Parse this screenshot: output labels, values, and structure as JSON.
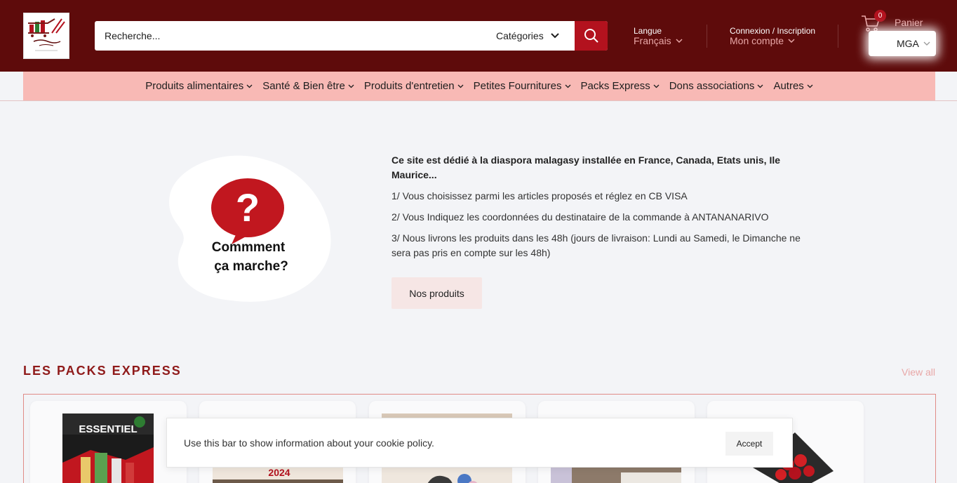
{
  "header": {
    "search_placeholder": "Recherche...",
    "categories_label": "Catégories",
    "language_label": "Langue",
    "language_value": "Français",
    "account_label": "Connexion / Inscription",
    "account_value": "Mon compte",
    "cart_count": "0",
    "cart_label": "Panier",
    "currency": "MGA"
  },
  "nav": [
    {
      "label": "Produits alimentaires"
    },
    {
      "label": "Santé & Bien être"
    },
    {
      "label": "Produits d'entretien"
    },
    {
      "label": "Petites Fournitures"
    },
    {
      "label": "Packs Express"
    },
    {
      "label": "Dons associations"
    },
    {
      "label": "Autres"
    }
  ],
  "hero": {
    "image_line1": "Commment",
    "image_line2": "ça marche?",
    "lead": "Ce site est dédié à la diaspora malagasy installée en France, Canada, Etats unis, Ile Maurice...",
    "steps": [
      "1/ Vous choisissez parmi les articles proposés et réglez en CB VISA",
      "2/ Vous Indiquez les coordonnées du destinataire de la commande à ANTANANARIVO",
      "3/ Nous livrons les produits dans les 48h (jours de livraison: Lundi au Samedi, le Dimanche ne sera pas pris en compte sur les 48h)"
    ],
    "button": "Nos produits"
  },
  "section": {
    "title": "LES PACKS EXPRESS",
    "view_all": "View all",
    "card1_tag": "ESSENTIEL",
    "card2_year": "2024"
  },
  "cookie": {
    "text": "Use this bar to show information about your cookie policy.",
    "button": "Accept"
  },
  "colors": {
    "header_bg": "#5e0b0b",
    "accent": "#b3121e",
    "nav_bg": "#f8b9b5",
    "muted_pink": "#e8a7a7",
    "title_red": "#8f1a1a"
  }
}
